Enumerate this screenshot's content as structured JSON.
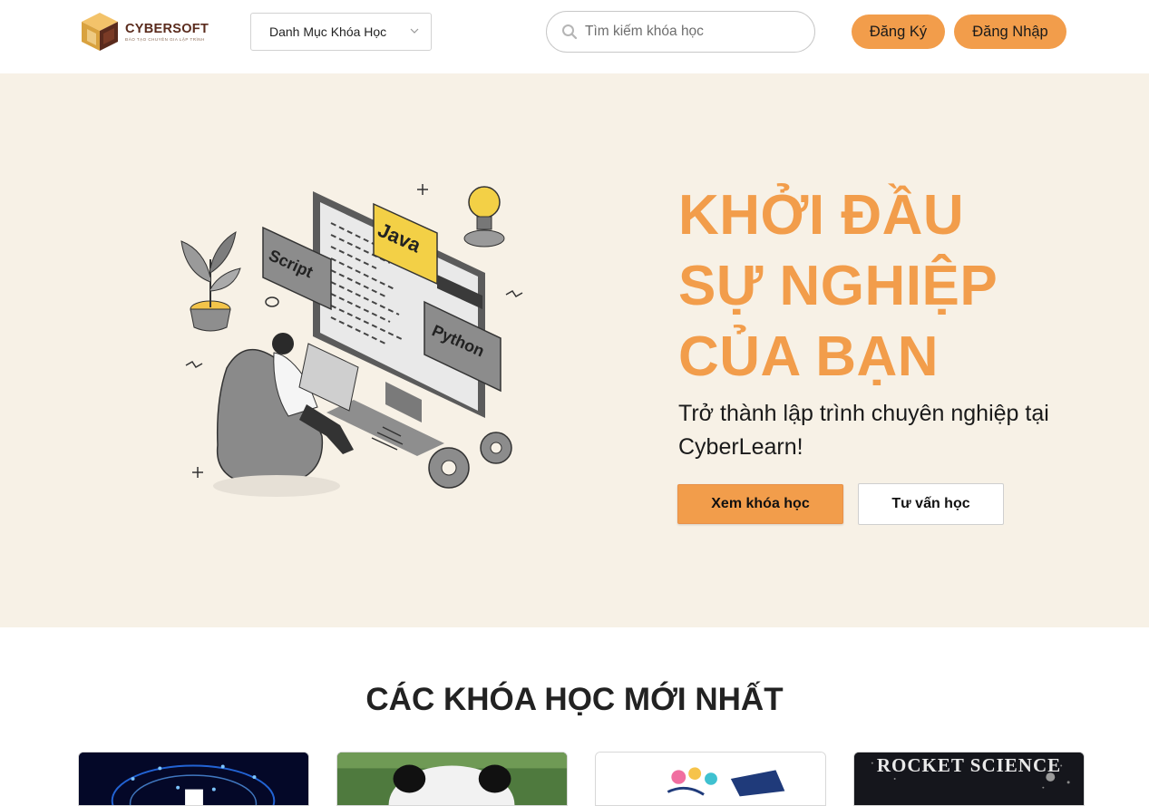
{
  "header": {
    "logo": {
      "name": "CYBERSOFT",
      "tagline": "ĐÀO TẠO CHUYÊN GIA LẬP TRÌNH"
    },
    "category_label": "Danh Mục Khóa Học",
    "search": {
      "placeholder": "Tìm kiếm khóa học",
      "value": ""
    },
    "register_label": "Đăng Ký",
    "login_label": "Đăng Nhập"
  },
  "hero": {
    "title_lines": [
      "KHỞI ĐẦU",
      "SỰ NGHIỆP",
      "CỦA BẠN"
    ],
    "subtitle": "Trở thành lập trình chuyên nghiệp tại CyberLearn!",
    "illustration_labels": {
      "script": "Script",
      "java": "Java",
      "python": "Python"
    },
    "view_courses_label": "Xem khóa học",
    "consult_label": "Tư vấn học"
  },
  "courses": {
    "section_title": "CÁC KHÓA HỌC MỚI NHẤT",
    "card4_image_text": "ROCKET SCIENCE"
  },
  "colors": {
    "accent": "#f29d4b",
    "hero_bg": "#f7f1e6",
    "logo_brown": "#5a2b1d"
  }
}
